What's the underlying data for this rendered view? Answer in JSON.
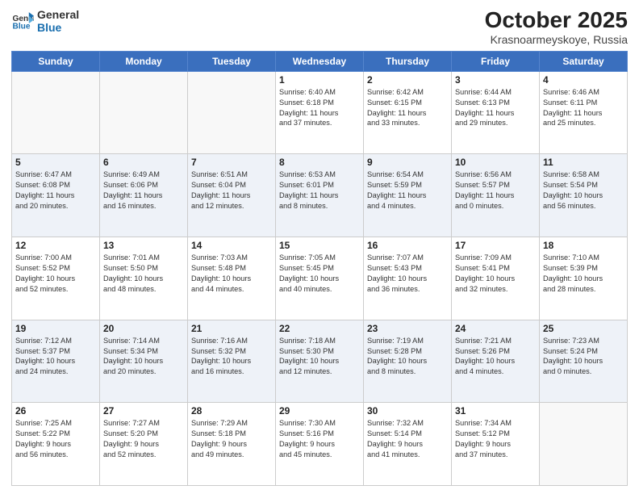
{
  "header": {
    "logo_line1": "General",
    "logo_line2": "Blue",
    "title": "October 2025",
    "subtitle": "Krasnoarmeyskoye, Russia"
  },
  "days_of_week": [
    "Sunday",
    "Monday",
    "Tuesday",
    "Wednesday",
    "Thursday",
    "Friday",
    "Saturday"
  ],
  "weeks": [
    [
      {
        "day": "",
        "info": ""
      },
      {
        "day": "",
        "info": ""
      },
      {
        "day": "",
        "info": ""
      },
      {
        "day": "1",
        "info": "Sunrise: 6:40 AM\nSunset: 6:18 PM\nDaylight: 11 hours\nand 37 minutes."
      },
      {
        "day": "2",
        "info": "Sunrise: 6:42 AM\nSunset: 6:15 PM\nDaylight: 11 hours\nand 33 minutes."
      },
      {
        "day": "3",
        "info": "Sunrise: 6:44 AM\nSunset: 6:13 PM\nDaylight: 11 hours\nand 29 minutes."
      },
      {
        "day": "4",
        "info": "Sunrise: 6:46 AM\nSunset: 6:11 PM\nDaylight: 11 hours\nand 25 minutes."
      }
    ],
    [
      {
        "day": "5",
        "info": "Sunrise: 6:47 AM\nSunset: 6:08 PM\nDaylight: 11 hours\nand 20 minutes."
      },
      {
        "day": "6",
        "info": "Sunrise: 6:49 AM\nSunset: 6:06 PM\nDaylight: 11 hours\nand 16 minutes."
      },
      {
        "day": "7",
        "info": "Sunrise: 6:51 AM\nSunset: 6:04 PM\nDaylight: 11 hours\nand 12 minutes."
      },
      {
        "day": "8",
        "info": "Sunrise: 6:53 AM\nSunset: 6:01 PM\nDaylight: 11 hours\nand 8 minutes."
      },
      {
        "day": "9",
        "info": "Sunrise: 6:54 AM\nSunset: 5:59 PM\nDaylight: 11 hours\nand 4 minutes."
      },
      {
        "day": "10",
        "info": "Sunrise: 6:56 AM\nSunset: 5:57 PM\nDaylight: 11 hours\nand 0 minutes."
      },
      {
        "day": "11",
        "info": "Sunrise: 6:58 AM\nSunset: 5:54 PM\nDaylight: 10 hours\nand 56 minutes."
      }
    ],
    [
      {
        "day": "12",
        "info": "Sunrise: 7:00 AM\nSunset: 5:52 PM\nDaylight: 10 hours\nand 52 minutes."
      },
      {
        "day": "13",
        "info": "Sunrise: 7:01 AM\nSunset: 5:50 PM\nDaylight: 10 hours\nand 48 minutes."
      },
      {
        "day": "14",
        "info": "Sunrise: 7:03 AM\nSunset: 5:48 PM\nDaylight: 10 hours\nand 44 minutes."
      },
      {
        "day": "15",
        "info": "Sunrise: 7:05 AM\nSunset: 5:45 PM\nDaylight: 10 hours\nand 40 minutes."
      },
      {
        "day": "16",
        "info": "Sunrise: 7:07 AM\nSunset: 5:43 PM\nDaylight: 10 hours\nand 36 minutes."
      },
      {
        "day": "17",
        "info": "Sunrise: 7:09 AM\nSunset: 5:41 PM\nDaylight: 10 hours\nand 32 minutes."
      },
      {
        "day": "18",
        "info": "Sunrise: 7:10 AM\nSunset: 5:39 PM\nDaylight: 10 hours\nand 28 minutes."
      }
    ],
    [
      {
        "day": "19",
        "info": "Sunrise: 7:12 AM\nSunset: 5:37 PM\nDaylight: 10 hours\nand 24 minutes."
      },
      {
        "day": "20",
        "info": "Sunrise: 7:14 AM\nSunset: 5:34 PM\nDaylight: 10 hours\nand 20 minutes."
      },
      {
        "day": "21",
        "info": "Sunrise: 7:16 AM\nSunset: 5:32 PM\nDaylight: 10 hours\nand 16 minutes."
      },
      {
        "day": "22",
        "info": "Sunrise: 7:18 AM\nSunset: 5:30 PM\nDaylight: 10 hours\nand 12 minutes."
      },
      {
        "day": "23",
        "info": "Sunrise: 7:19 AM\nSunset: 5:28 PM\nDaylight: 10 hours\nand 8 minutes."
      },
      {
        "day": "24",
        "info": "Sunrise: 7:21 AM\nSunset: 5:26 PM\nDaylight: 10 hours\nand 4 minutes."
      },
      {
        "day": "25",
        "info": "Sunrise: 7:23 AM\nSunset: 5:24 PM\nDaylight: 10 hours\nand 0 minutes."
      }
    ],
    [
      {
        "day": "26",
        "info": "Sunrise: 7:25 AM\nSunset: 5:22 PM\nDaylight: 9 hours\nand 56 minutes."
      },
      {
        "day": "27",
        "info": "Sunrise: 7:27 AM\nSunset: 5:20 PM\nDaylight: 9 hours\nand 52 minutes."
      },
      {
        "day": "28",
        "info": "Sunrise: 7:29 AM\nSunset: 5:18 PM\nDaylight: 9 hours\nand 49 minutes."
      },
      {
        "day": "29",
        "info": "Sunrise: 7:30 AM\nSunset: 5:16 PM\nDaylight: 9 hours\nand 45 minutes."
      },
      {
        "day": "30",
        "info": "Sunrise: 7:32 AM\nSunset: 5:14 PM\nDaylight: 9 hours\nand 41 minutes."
      },
      {
        "day": "31",
        "info": "Sunrise: 7:34 AM\nSunset: 5:12 PM\nDaylight: 9 hours\nand 37 minutes."
      },
      {
        "day": "",
        "info": ""
      }
    ]
  ]
}
